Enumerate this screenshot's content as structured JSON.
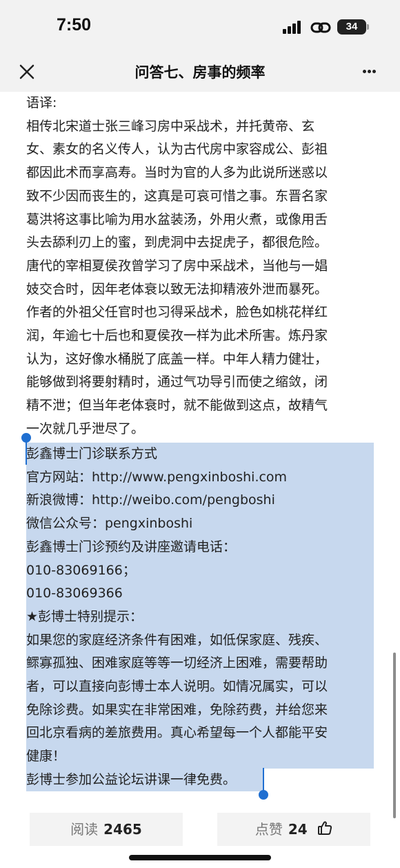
{
  "status_bar": {
    "time": "7:50",
    "battery": "34"
  },
  "nav": {
    "title": "问答七、房事的频率"
  },
  "article": {
    "lines": [
      "语译:",
      "相传北宋道士张三峰习房中采战术，并托黄帝、玄",
      "女、素女的名义传人，认为古代房中家容成公、彭祖",
      "都因此术而享高寿。当时为官的人多为此说所迷惑以",
      "致不少因而丧生的，这真是可哀可惜之事。东晋名家",
      "葛洪将这事比喻为用水盆装汤，外用火煮，或像用舌",
      "头去舔利刃上的蜜，到虎洞中去捉虎子，都很危险。",
      "唐代的宰相夏侯孜曾学习了房中采战术，当他与一娼",
      "妓交合时，因年老体衰以致无法抑精液外泄而暴死。",
      "作者的外祖父任官时也习得采战术，脸色如桃花样红",
      "润，年逾七十后也和夏侯孜一样为此术所害。炼丹家",
      "认为，这好像水桶脱了底盖一样。中年人精力健壮，",
      "能够做到将要射精时，通过气功导引而使之缩敛，闭",
      "精不泄；但当年老体衰时，就不能做到这点，故精气",
      "一次就几乎泄尽了。"
    ]
  },
  "contact": {
    "lines": [
      "彭鑫博士门诊联系方式",
      "官方网站：http://www.pengxinboshi.com",
      "新浪微博：http://weibo.com/pengboshi",
      "微信公众号：pengxinboshi",
      "彭鑫博士门诊预约及讲座邀请电话：",
      "010-83069166；",
      "010-83069366",
      "★彭博士特别提示：",
      "如果您的家庭经济条件有困难，如低保家庭、残疾、",
      "鳏寡孤独、困难家庭等等一切经济上困难，需要帮助",
      "者，可以直接向彭博士本人说明。如情况属实，可以",
      "免除诊费。如果实在非常困难，免除药费，并给您来",
      "回北京看病的差旅费用。真心希望每一个人都能平安",
      "健康！",
      "彭博士参加公益论坛讲课一律免费。"
    ]
  },
  "footer": {
    "read_label": "阅读",
    "read_count": "2465",
    "like_label": "点赞",
    "like_count": "24"
  },
  "colors": {
    "selection": "#c7d8ee",
    "selection_handle": "#1f6fd1",
    "bar_background": "#f2f2f2"
  },
  "icons": [
    "close-icon",
    "more-icon",
    "thumbs-up-icon",
    "signal-icon",
    "link-icon",
    "battery-icon"
  ]
}
